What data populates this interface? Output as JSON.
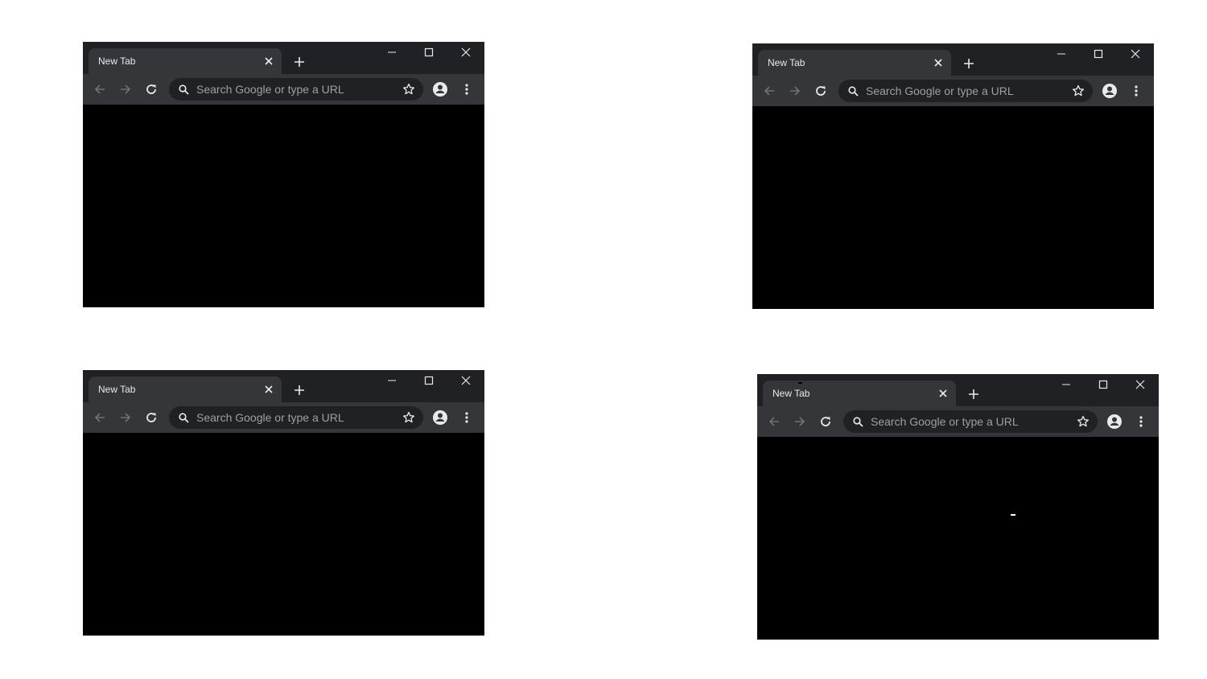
{
  "colors": {
    "titlebar": "#202124",
    "tab": "#35363a",
    "toolbar": "#35363a",
    "omnibox": "#202124",
    "icon": "#e8eaed",
    "icon_disabled": "#6f7175",
    "placeholder": "#9aa0a6",
    "content": "#000000",
    "page_background": "#ffffff"
  },
  "icons": {
    "tab_close": "close-icon",
    "new_tab": "plus-icon",
    "minimize": "minimize-icon",
    "maximize": "maximize-icon",
    "close": "close-icon",
    "back": "arrow-left-icon",
    "forward": "arrow-right-icon",
    "reload": "reload-icon",
    "search": "search-icon",
    "bookmark": "star-icon",
    "profile": "account-circle-icon",
    "menu": "more-vertical-icon"
  },
  "windows": [
    {
      "tab": {
        "title": "New Tab"
      },
      "omnibox": {
        "placeholder": "Search Google or type a URL"
      }
    },
    {
      "tab": {
        "title": "New Tab"
      },
      "omnibox": {
        "placeholder": "Search Google or type a URL"
      }
    },
    {
      "tab": {
        "title": "New Tab"
      },
      "omnibox": {
        "placeholder": "Search Google or type a URL"
      }
    },
    {
      "tab": {
        "title": "New Tab"
      },
      "omnibox": {
        "placeholder": "Search Google or type a URL"
      }
    }
  ]
}
